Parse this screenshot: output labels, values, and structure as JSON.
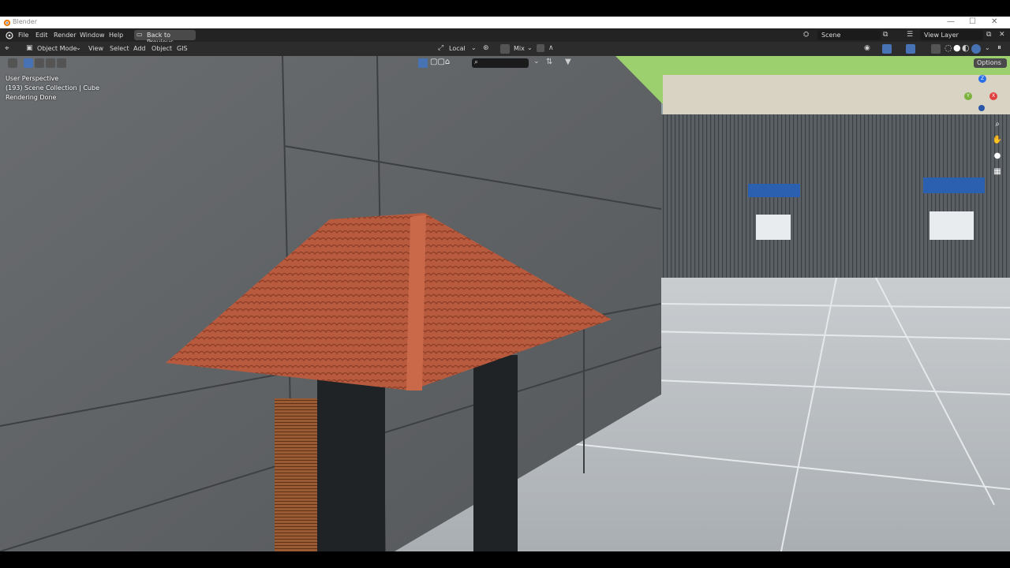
{
  "window": {
    "title": "Blender",
    "controls": {
      "minimize": "—",
      "maximize": "☐",
      "close": "✕"
    }
  },
  "menubar": {
    "items": [
      "File",
      "Edit",
      "Render",
      "Window",
      "Help"
    ],
    "back_button": "Back to Previous",
    "scene_label": "Scene",
    "view_layer_label": "View Layer"
  },
  "header": {
    "mode": "Object Mode",
    "menus": [
      "View",
      "Select",
      "Add",
      "Object",
      "GIS"
    ],
    "transform_orientation": "Local",
    "snap_mode": "Mix",
    "options_label": "Options"
  },
  "viewport": {
    "overlay_lines": [
      "User Perspective",
      "(193) Scene Collection | Cube",
      "Rendering Done"
    ],
    "gizmo_axes": {
      "z": "Z",
      "x": "X",
      "y": "Y"
    },
    "colors": {
      "wall": "#5d6063",
      "roof": "#b85a3e",
      "pillar": "#1f2326",
      "floor": "#b9bec1",
      "sky": "#9ccf6e",
      "fence": "#54595e",
      "sign": "#2b5fb0"
    }
  },
  "icons": {
    "blender": "blender-logo-icon",
    "editor_type": "3d-viewport-icon",
    "nav": [
      "zoom-icon",
      "pan-hand-icon",
      "camera-icon",
      "grid-icon"
    ]
  }
}
